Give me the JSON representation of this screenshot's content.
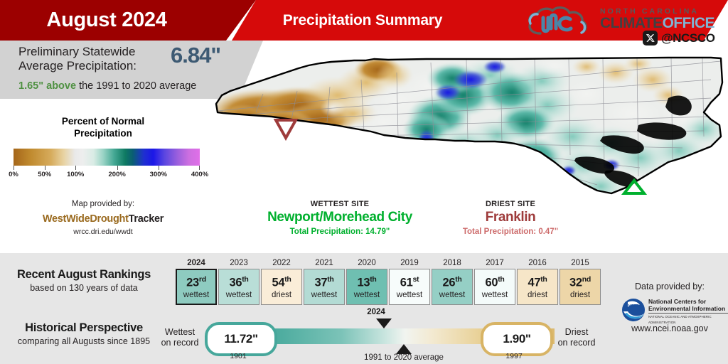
{
  "banner": {
    "month_year": "August 2024",
    "title": "Precipitation Summary"
  },
  "logo": {
    "line1": "NORTH CAROLINA",
    "climate": "CLIMATE",
    "office": "OFFICE",
    "x_icon": "x-twitter-icon",
    "handle": "@NCSCO"
  },
  "statewide": {
    "label": "Preliminary Statewide\nAverage Precipitation:",
    "label_line1": "Preliminary Statewide",
    "label_line2": "Average Precipitation:",
    "value": "6.84\"",
    "departure": "1.65\" above",
    "departure_rest": " the 1991 to 2020 average"
  },
  "legend": {
    "title_line1": "Percent of Normal",
    "title_line2": "Precipitation",
    "ticks": [
      "0%",
      "50%",
      "100%",
      "200%",
      "300%",
      "400%"
    ],
    "tick_positions": [
      0,
      16.7,
      33.3,
      55.6,
      77.8,
      100
    ],
    "credit": "Map provided by:",
    "provider_a": "WestWideDrought",
    "provider_b": "Tracker",
    "url": "wrcc.dri.edu/wwdt"
  },
  "map": {
    "marker_wettest": "green-triangle-marker",
    "marker_driest": "red-inverted-triangle-marker",
    "state": "North Carolina"
  },
  "wettest_site": {
    "kicker": "WETTEST SITE",
    "name": "Newport/Morehead City",
    "total": "Total Precipitation: 14.79\"",
    "color": "#00b02e"
  },
  "driest_site": {
    "kicker": "DRIEST SITE",
    "name": "Franklin",
    "total": "Total Precipitation: 0.47\"",
    "color": "#9e3b3b"
  },
  "rankings": {
    "title": "Recent August Rankings",
    "subtitle": "based on 130 years of data",
    "items": [
      {
        "year": "2024",
        "rank": "23",
        "suffix": "rd",
        "word": "wettest",
        "color": "#8ecbc0",
        "current": true
      },
      {
        "year": "2023",
        "rank": "36",
        "suffix": "th",
        "word": "wettest",
        "color": "#b9ded7",
        "current": false
      },
      {
        "year": "2022",
        "rank": "54",
        "suffix": "th",
        "word": "driest",
        "color": "#faedd8",
        "current": false
      },
      {
        "year": "2021",
        "rank": "37",
        "suffix": "th",
        "word": "wettest",
        "color": "#b3dbd4",
        "current": false
      },
      {
        "year": "2020",
        "rank": "13",
        "suffix": "th",
        "word": "wettest",
        "color": "#6fbfb1",
        "current": false
      },
      {
        "year": "2019",
        "rank": "61",
        "suffix": "st",
        "word": "wettest",
        "color": "#f7fcfb",
        "current": false
      },
      {
        "year": "2018",
        "rank": "26",
        "suffix": "th",
        "word": "wettest",
        "color": "#95cfc5",
        "current": false
      },
      {
        "year": "2017",
        "rank": "60",
        "suffix": "th",
        "word": "wettest",
        "color": "#f4fbfa",
        "current": false
      },
      {
        "year": "2016",
        "rank": "47",
        "suffix": "th",
        "word": "driest",
        "color": "#f6e6c8",
        "current": false
      },
      {
        "year": "2015",
        "rank": "32",
        "suffix": "nd",
        "word": "driest",
        "color": "#edd6a8",
        "current": false
      }
    ]
  },
  "historical": {
    "title": "Historical Perspective",
    "subtitle": "comparing all Augusts since 1895",
    "wettest_label_l1": "Wettest",
    "wettest_label_l2": "on record",
    "wettest_value": "11.72\"",
    "wettest_year": "1901",
    "driest_label_l1": "Driest",
    "driest_label_l2": "on record",
    "driest_value": "1.90\"",
    "driest_year": "1997",
    "marker_current": "2024",
    "marker_average": "1991 to 2020 average",
    "wet_color": "#46a79b",
    "dry_color": "#d8b465"
  },
  "ncei": {
    "title": "Data provided by:",
    "line1": "National Centers for",
    "line2": "Environmental Information",
    "line3": "NATIONAL OCEANIC AND ATMOSPHERIC ADMINISTRATION",
    "url": "www.ncei.noaa.gov"
  }
}
